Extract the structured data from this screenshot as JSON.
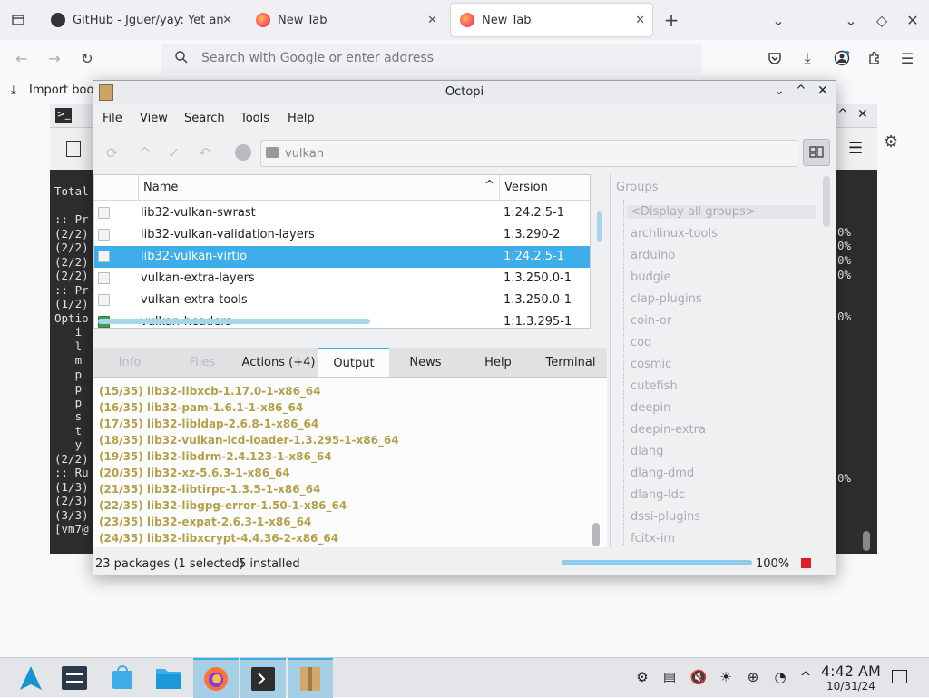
{
  "browser": {
    "tabs": [
      {
        "title": "GitHub - Jguer/yay: Yet an",
        "icon": "github-icon",
        "active": false
      },
      {
        "title": "New Tab",
        "icon": "firefox-icon",
        "active": false
      },
      {
        "title": "New Tab",
        "icon": "firefox-icon",
        "active": true
      }
    ],
    "new_tab": "+",
    "address_placeholder": "Search with Google or enter address",
    "bookmarks_import": "Import boo"
  },
  "terminal": {
    "left_lines": [
      "Total",
      "",
      ":: Pr",
      "(2/2)",
      "(2/2)",
      "(2/2)",
      "(2/2)",
      ":: Pr",
      "(1/2)",
      "Optio",
      "   i",
      "   l",
      "   m",
      "   p",
      "   p",
      "   p",
      "   s",
      "   t",
      "   y",
      "(2/2)",
      ":: Ru",
      "(1/3)",
      "(2/3)",
      "(3/3)",
      "[vm7@"
    ],
    "right_lines": [
      "0%",
      "0%",
      "0%",
      "0%",
      "0%",
      "0%"
    ]
  },
  "octopi": {
    "title": "Octopi",
    "menu": [
      "File",
      "View",
      "Search",
      "Tools",
      "Help"
    ],
    "search_value": "vulkan",
    "columns": {
      "name": "Name",
      "version": "Version"
    },
    "packages": [
      {
        "name": "lib32-vulkan-swrast",
        "version": "1:24.2.5-1",
        "installed": false,
        "selected": false
      },
      {
        "name": "lib32-vulkan-validation-layers",
        "version": "1.3.290-2",
        "installed": false,
        "selected": false
      },
      {
        "name": "lib32-vulkan-virtio",
        "version": "1:24.2.5-1",
        "installed": false,
        "selected": true
      },
      {
        "name": "vulkan-extra-layers",
        "version": "1.3.250.0-1",
        "installed": false,
        "selected": false
      },
      {
        "name": "vulkan-extra-tools",
        "version": "1.3.250.0-1",
        "installed": false,
        "selected": false
      },
      {
        "name": "vulkan-headers",
        "version": "1:1.3.295-1",
        "installed": true,
        "selected": false
      }
    ],
    "groups_header": "Groups",
    "groups": [
      "<Display all groups>",
      "archlinux-tools",
      "arduino",
      "budgie",
      "clap-plugins",
      "coin-or",
      "coq",
      "cosmic",
      "cutefish",
      "deepin",
      "deepin-extra",
      "dlang",
      "dlang-dmd",
      "dlang-ldc",
      "dssi-plugins",
      "fcitx-im"
    ],
    "tabs": [
      {
        "label": "Info",
        "state": "disabled"
      },
      {
        "label": "Files",
        "state": "disabled"
      },
      {
        "label": "Actions (+4)",
        "state": "normal"
      },
      {
        "label": "Output",
        "state": "active"
      },
      {
        "label": "News",
        "state": "normal"
      },
      {
        "label": "Help",
        "state": "normal"
      },
      {
        "label": "Terminal",
        "state": "normal"
      }
    ],
    "output": [
      "(15/35) lib32-libxcb-1.17.0-1-x86_64",
      "(16/35) lib32-pam-1.6.1-1-x86_64",
      "(17/35) lib32-libldap-2.6.8-1-x86_64",
      "(18/35) lib32-vulkan-icd-loader-1.3.295-1-x86_64",
      "(19/35) lib32-libdrm-2.4.123-1-x86_64",
      "(20/35) lib32-xz-5.6.3-1-x86_64",
      "(21/35) lib32-libtirpc-1.3.5-1-x86_64",
      "(22/35) lib32-libgpg-error-1.50-1-x86_64",
      "(23/35) lib32-expat-2.6.3-1-x86_64",
      "(24/35) lib32-libxcrypt-4.4.36-2-x86_64"
    ],
    "status": {
      "packages": "23 packages (1 selected)",
      "installed": "5 installed",
      "progress_label": "100%",
      "progress": 1.0
    },
    "colors": {
      "accent": "#3daee9",
      "output_text": "#b5a04a",
      "installed": "#3fa048",
      "stop": "#e02020"
    }
  },
  "taskbar": {
    "clock_time": "4:42 AM",
    "clock_date": "10/31/24"
  }
}
